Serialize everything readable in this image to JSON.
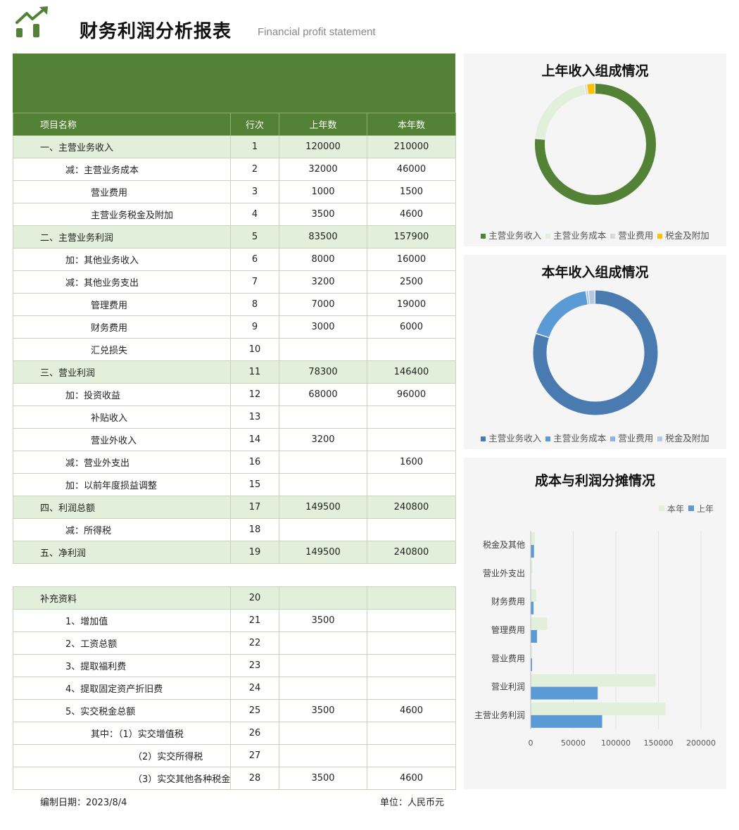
{
  "header": {
    "title": "财务利润分析报表",
    "subtitle": "Financial profit statement"
  },
  "table": {
    "columns": [
      "项目名称",
      "行次",
      "上年数",
      "本年数"
    ],
    "rows": [
      {
        "name": "一、主营业务收入",
        "no": "1",
        "prev": "120000",
        "curr": "210000",
        "kind": "sec",
        "indent": 0
      },
      {
        "name": "减：主营业务成本",
        "no": "2",
        "prev": "32000",
        "curr": "46000",
        "kind": "row",
        "indent": 1
      },
      {
        "name": "营业费用",
        "no": "3",
        "prev": "1000",
        "curr": "1500",
        "kind": "row",
        "indent": 2
      },
      {
        "name": "主营业务税金及附加",
        "no": "4",
        "prev": "3500",
        "curr": "4600",
        "kind": "row",
        "indent": 2
      },
      {
        "name": "二、主营业务利润",
        "no": "5",
        "prev": "83500",
        "curr": "157900",
        "kind": "sec",
        "indent": 0
      },
      {
        "name": "加：其他业务收入",
        "no": "6",
        "prev": "8000",
        "curr": "16000",
        "kind": "row",
        "indent": 1
      },
      {
        "name": "减：其他业务支出",
        "no": "7",
        "prev": "3200",
        "curr": "2500",
        "kind": "row",
        "indent": 1
      },
      {
        "name": "管理费用",
        "no": "8",
        "prev": "7000",
        "curr": "19000",
        "kind": "row",
        "indent": 2
      },
      {
        "name": "财务费用",
        "no": "9",
        "prev": "3000",
        "curr": "6000",
        "kind": "row",
        "indent": 2
      },
      {
        "name": "汇兑损失",
        "no": "10",
        "prev": "",
        "curr": "",
        "kind": "row",
        "indent": 2
      },
      {
        "name": "三、营业利润",
        "no": "11",
        "prev": "78300",
        "curr": "146400",
        "kind": "sec",
        "indent": 0
      },
      {
        "name": "加：投资收益",
        "no": "12",
        "prev": "68000",
        "curr": "96000",
        "kind": "row",
        "indent": 1
      },
      {
        "name": "补贴收入",
        "no": "13",
        "prev": "",
        "curr": "",
        "kind": "row",
        "indent": 2
      },
      {
        "name": "营业外收入",
        "no": "14",
        "prev": "3200",
        "curr": "",
        "kind": "row",
        "indent": 2
      },
      {
        "name": "减：营业外支出",
        "no": "16",
        "prev": "",
        "curr": "1600",
        "kind": "row",
        "indent": 1
      },
      {
        "name": "加：以前年度损益调整",
        "no": "15",
        "prev": "",
        "curr": "",
        "kind": "row",
        "indent": 1
      },
      {
        "name": "四、利润总额",
        "no": "17",
        "prev": "149500",
        "curr": "240800",
        "kind": "sec",
        "indent": 0
      },
      {
        "name": "减：所得税",
        "no": "18",
        "prev": "",
        "curr": "",
        "kind": "row",
        "indent": 1
      },
      {
        "name": "五、净利润",
        "no": "19",
        "prev": "149500",
        "curr": "240800",
        "kind": "sec",
        "indent": 0
      }
    ],
    "supplement": [
      {
        "name": "补充资料",
        "no": "20",
        "prev": "",
        "curr": "",
        "kind": "sec",
        "indent": 0
      },
      {
        "name": "1、增加值",
        "no": "21",
        "prev": "3500",
        "curr": "",
        "kind": "row",
        "indent": 1
      },
      {
        "name": "2、工资总额",
        "no": "22",
        "prev": "",
        "curr": "",
        "kind": "row",
        "indent": 1
      },
      {
        "name": "3、提取福利费",
        "no": "23",
        "prev": "",
        "curr": "",
        "kind": "row",
        "indent": 1
      },
      {
        "name": "4、提取固定资产折旧费",
        "no": "24",
        "prev": "",
        "curr": "",
        "kind": "row",
        "indent": 1
      },
      {
        "name": "5、实交税金总额",
        "no": "25",
        "prev": "3500",
        "curr": "4600",
        "kind": "row",
        "indent": 1
      },
      {
        "name": "其中：（1）实交增值税",
        "no": "26",
        "prev": "",
        "curr": "",
        "kind": "row",
        "indent": 2
      },
      {
        "name": "（2）实交所得税",
        "no": "27",
        "prev": "",
        "curr": "",
        "kind": "row",
        "indent": 3
      },
      {
        "name": "（3）实交其他各种税金及附加",
        "no": "28",
        "prev": "3500",
        "curr": "4600",
        "kind": "row",
        "indent": 3
      }
    ]
  },
  "footer": {
    "date_label": "编制日期：2023/8/4",
    "unit_label": "单位：人民币元"
  },
  "colors": {
    "brand_green": "#538135",
    "section_green": "#e2efda",
    "panel_bg": "#f5f5f5",
    "blue_dark": "#4a7bb0",
    "blue_mid": "#5b9bd5",
    "blue_light": "#b4c7e7",
    "green_light": "#e2efda",
    "gold": "#ffc000"
  },
  "chart_data": [
    {
      "type": "pie",
      "title": "上年收入组成情况",
      "categories": [
        "主营业务收入",
        "主营业务成本",
        "营业费用",
        "税金及附加"
      ],
      "values": [
        120000,
        32000,
        1000,
        3500
      ],
      "colors": [
        "#538135",
        "#e2efda",
        "#d9d9d9",
        "#ffc000"
      ],
      "legend": "bottom"
    },
    {
      "type": "pie",
      "title": "本年收入组成情况",
      "categories": [
        "主营业务收入",
        "主营业务成本",
        "营业费用",
        "税金及附加"
      ],
      "values": [
        210000,
        46000,
        1500,
        4600
      ],
      "colors": [
        "#4a7bb0",
        "#5b9bd5",
        "#8eb4e3",
        "#b4c7e7"
      ],
      "legend": "bottom"
    },
    {
      "type": "bar",
      "orientation": "horizontal",
      "title": "成本与利润分摊情况",
      "categories": [
        "主营业务利润",
        "营业利润",
        "营业费用",
        "管理费用",
        "财务费用",
        "营业外支出",
        "税金及其他"
      ],
      "series": [
        {
          "name": "本年",
          "values": [
            157900,
            146400,
            1500,
            19000,
            6000,
            1600,
            4600
          ],
          "color": "#e2efda"
        },
        {
          "name": "上年",
          "values": [
            83500,
            78300,
            1000,
            7000,
            3000,
            0,
            3500
          ],
          "color": "#5b9bd5"
        }
      ],
      "xticks": [
        "0",
        "50000",
        "100000",
        "150000",
        "200000"
      ],
      "xlim": [
        0,
        200000
      ],
      "legend": "top-right",
      "grid": true
    }
  ]
}
